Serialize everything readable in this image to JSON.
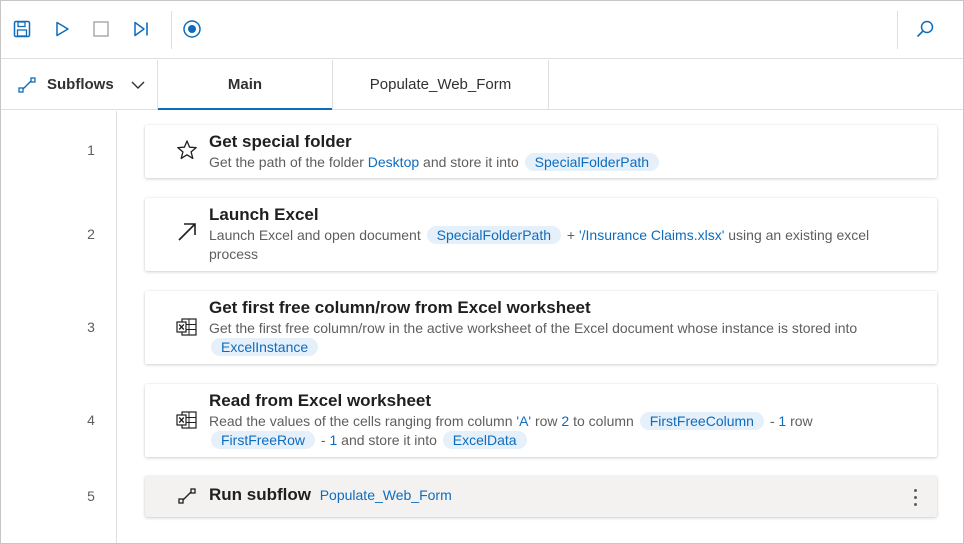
{
  "toolbar": {
    "buttons": [
      "save-icon",
      "run-icon",
      "stop-icon",
      "run-next-action-icon",
      "record-icon"
    ],
    "search": "search-icon"
  },
  "subflows": {
    "label": "Subflows"
  },
  "tabs": [
    {
      "label": "Main",
      "active": true
    },
    {
      "label": "Populate_Web_Form",
      "active": false
    }
  ],
  "actions": [
    {
      "line": "1",
      "icon": "star-icon",
      "title": "Get special folder",
      "desc": {
        "t1": "Get the path of the folder ",
        "lit1": "Desktop",
        "t2": " and store it into ",
        "var1": "SpecialFolderPath"
      }
    },
    {
      "line": "2",
      "icon": "launch-arrow-icon",
      "title": "Launch Excel",
      "desc": {
        "t1": "Launch Excel and open document ",
        "var1": "SpecialFolderPath",
        "t2": " + ",
        "lit1": "'/Insurance Claims.xlsx'",
        "t3": " using an existing excel process"
      }
    },
    {
      "line": "3",
      "icon": "excel-icon",
      "title": "Get first free column/row from Excel worksheet",
      "desc": {
        "t1": "Get the first free column/row in the active worksheet of the Excel document whose instance is stored into ",
        "var1": "ExcelInstance"
      }
    },
    {
      "line": "4",
      "icon": "excel-icon",
      "title": "Read from Excel worksheet",
      "desc": {
        "t1": "Read the values of the cells ranging from column ",
        "lit1": "'A'",
        "t2": " row ",
        "lit2": "2",
        "t3": " to column ",
        "var1": "FirstFreeColumn",
        "t4": " - ",
        "lit3": "1",
        "t5": " row ",
        "var2": "FirstFreeRow",
        "t6": " - ",
        "lit4": "1",
        "t7": " and store it into ",
        "var3": "ExcelData"
      }
    },
    {
      "line": "5",
      "icon": "subflow-icon",
      "title": "Run subflow",
      "subflow": "Populate_Web_Form",
      "more": "more-options-icon"
    }
  ],
  "colors": {
    "accent": "#0f6cbd",
    "var_bg": "#e5f0fb",
    "selected_bg": "#f3f2f1"
  }
}
